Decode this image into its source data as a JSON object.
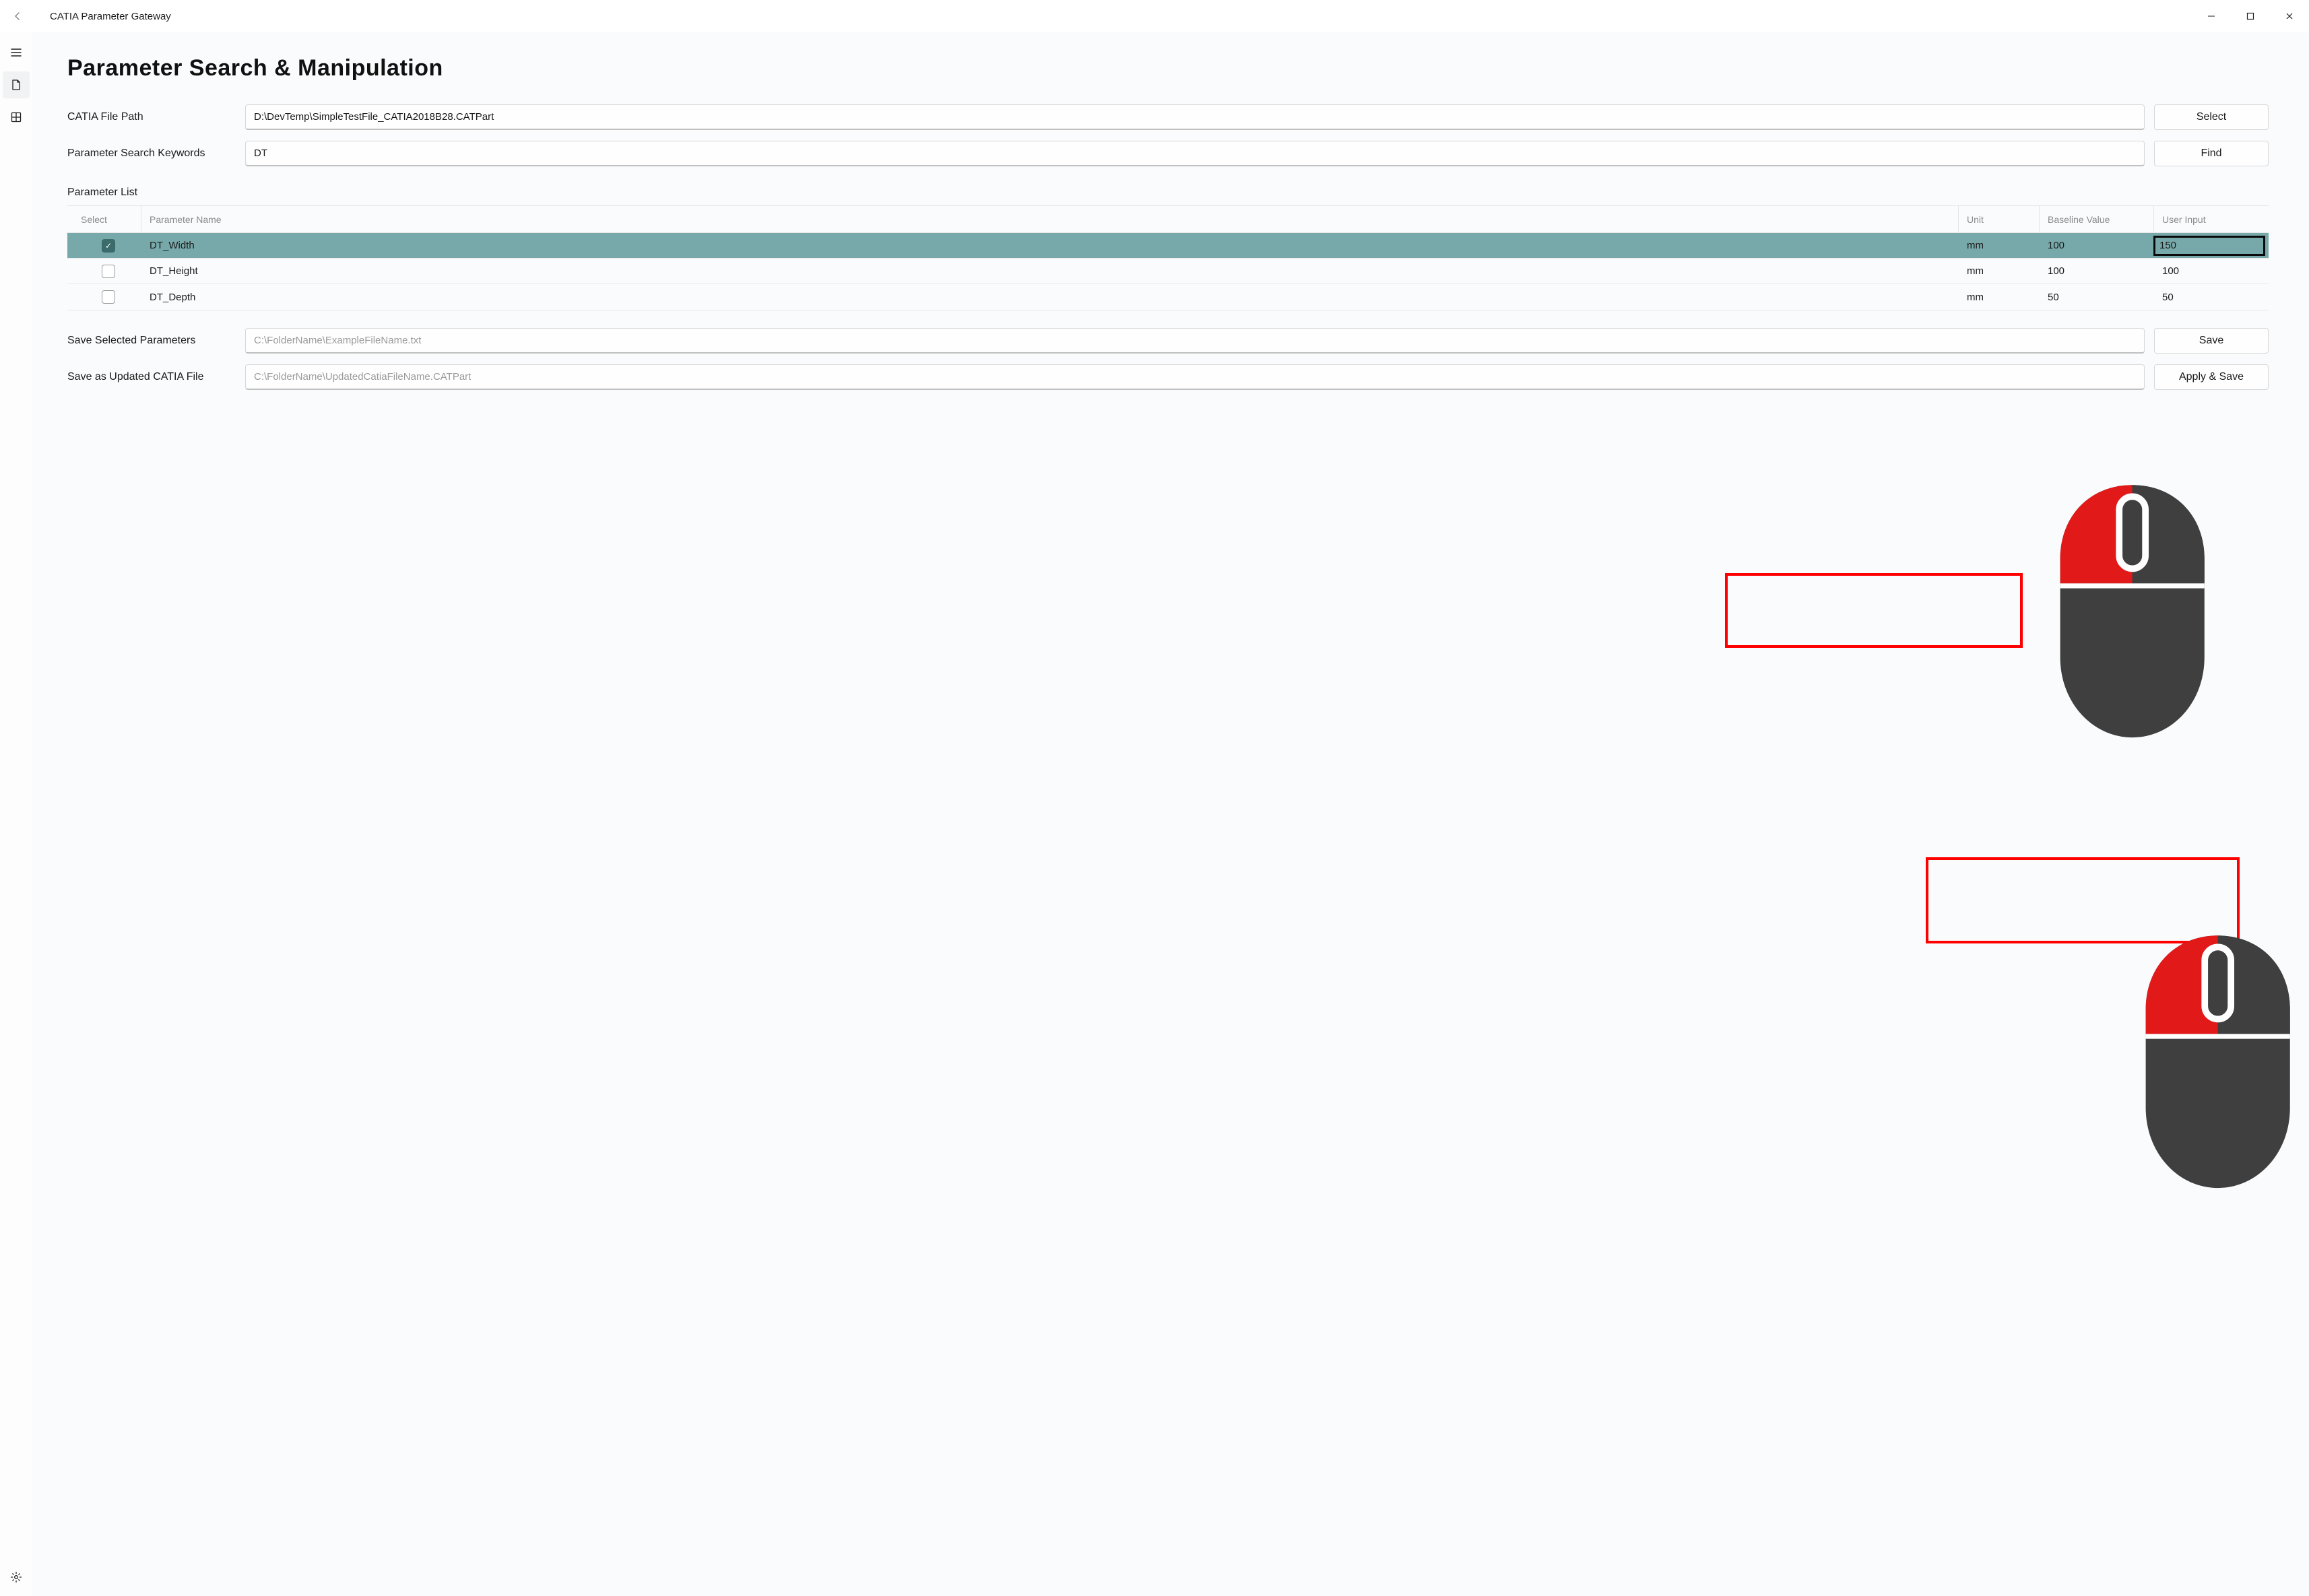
{
  "titlebar": {
    "title": "CATIA Parameter Gateway"
  },
  "page": {
    "heading": "Parameter Search & Manipulation"
  },
  "labels": {
    "file_path": "CATIA File Path",
    "search_keywords": "Parameter Search Keywords",
    "parameter_list": "Parameter List",
    "save_selected": "Save Selected Parameters",
    "save_updated": "Save as Updated CATIA File"
  },
  "inputs": {
    "file_path_value": "D:\\DevTemp\\SimpleTestFile_CATIA2018B28.CATPart",
    "search_value": "DT",
    "save_selected_placeholder": "C:\\FolderName\\ExampleFileName.txt",
    "save_updated_placeholder": "C:\\FolderName\\UpdatedCatiaFileName.CATPart"
  },
  "buttons": {
    "select": "Select",
    "find": "Find",
    "save": "Save",
    "apply_save": "Apply & Save"
  },
  "table": {
    "headers": {
      "select": "Select",
      "name": "Parameter Name",
      "unit": "Unit",
      "baseline": "Baseline Value",
      "user": "User Input"
    },
    "rows": [
      {
        "checked": true,
        "name": "DT_Width",
        "unit": "mm",
        "baseline": "100",
        "user": "150",
        "editing": true
      },
      {
        "checked": false,
        "name": "DT_Height",
        "unit": "mm",
        "baseline": "100",
        "user": "100",
        "editing": false
      },
      {
        "checked": false,
        "name": "DT_Depth",
        "unit": "mm",
        "baseline": "50",
        "user": "50",
        "editing": false
      }
    ]
  }
}
